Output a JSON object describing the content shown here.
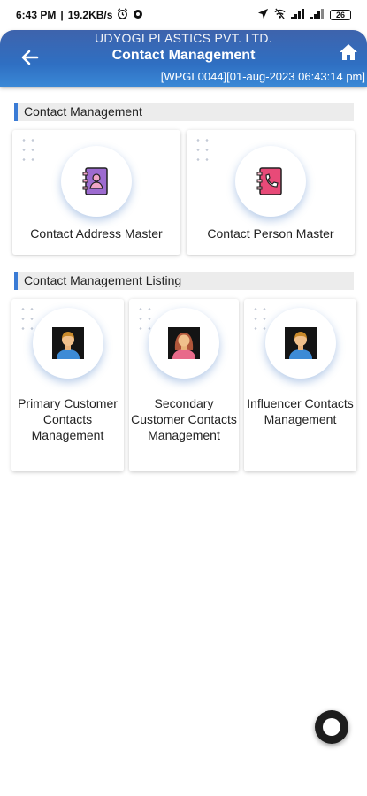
{
  "status_bar": {
    "time": "6:43 PM",
    "net_speed": "19.2KB/s",
    "battery": "26"
  },
  "header": {
    "company": "UDYOGI PLASTICS PVT. LTD.",
    "title": "Contact Management",
    "meta": "[WPGL0044][01-aug-2023 06:43:14 pm]"
  },
  "sections": [
    {
      "title": "Contact Management",
      "cards": [
        {
          "label": "Contact Address Master",
          "icon": "address-book-icon"
        },
        {
          "label": "Contact Person Master",
          "icon": "phone-book-icon"
        }
      ]
    },
    {
      "title": "Contact Management Listing",
      "cards": [
        {
          "label": "Primary Customer Contacts Management",
          "icon": "man-avatar-icon"
        },
        {
          "label": "Secondary Customer Contacts Management",
          "icon": "woman-avatar-icon"
        },
        {
          "label": "Influencer Contacts Management",
          "icon": "man-avatar-icon"
        }
      ]
    }
  ],
  "colors": {
    "header_gradient_start": "#3e63ac",
    "header_gradient_end": "#3a88d6",
    "section_accent": "#3a7bd5"
  }
}
